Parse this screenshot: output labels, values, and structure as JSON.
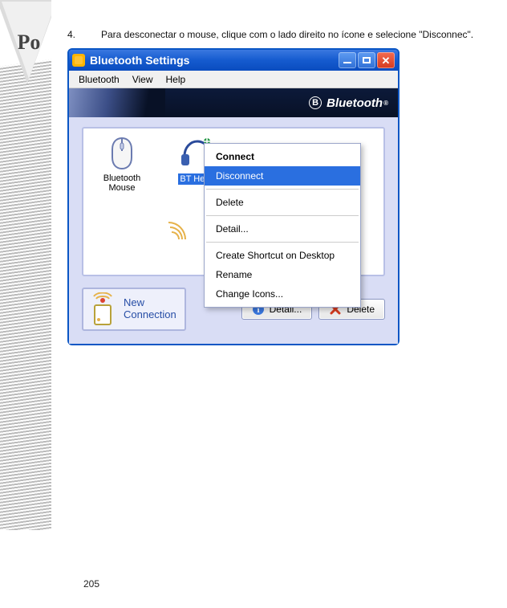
{
  "doc": {
    "step_number": "4.",
    "step_text": "Para desconectar o mouse, clique com o lado direito no ícone    e selecione \"Disconnec\".",
    "page_number": "205"
  },
  "window": {
    "title": "Bluetooth Settings",
    "menu": {
      "bluetooth": "Bluetooth",
      "view": "View",
      "help": "Help"
    },
    "brand": {
      "logo_text": "Bluetooth",
      "logo_mark": "B",
      "reg": "®"
    },
    "devices": {
      "mouse": {
        "label1": "Bluetooth",
        "label2": "Mouse",
        "icon_name": "mouse-icon"
      },
      "headset": {
        "label": "BT Head",
        "icon_name": "headset-icon"
      }
    },
    "context_menu": {
      "connect": "Connect",
      "disconnect": "Disconnect",
      "delete": "Delete",
      "detail": "Detail...",
      "shortcut": "Create Shortcut on Desktop",
      "rename": "Rename",
      "change_icons": "Change Icons..."
    },
    "buttons": {
      "new_connection_l1": "New",
      "new_connection_l2": "Connection",
      "detail": "Detail...",
      "delete": "Delete"
    }
  }
}
